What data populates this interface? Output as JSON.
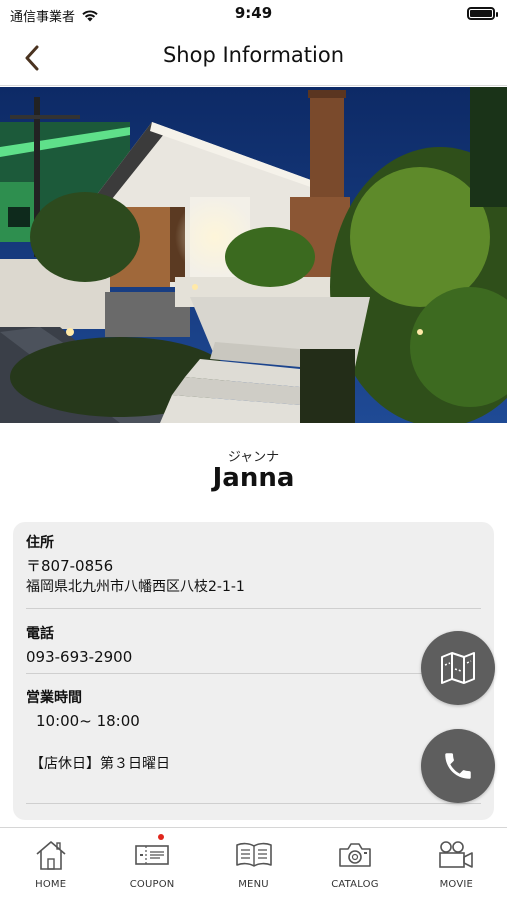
{
  "status_bar": {
    "carrier": "通信事業者",
    "time": "9:49"
  },
  "nav": {
    "title": "Shop Information"
  },
  "shop": {
    "name_kana": "ジャンナ",
    "name": "Janna"
  },
  "info": {
    "address": {
      "label": "住所",
      "postal": "〒807-0856",
      "line": "福岡県北九州市八幡西区八枝2-1-1"
    },
    "phone": {
      "label": "電話",
      "number": "093-693-2900"
    },
    "hours": {
      "label": "営業時間",
      "time": "10:00~ 18:00",
      "closed": "【店休日】第３日曜日"
    }
  },
  "tabs": [
    {
      "label": "HOME",
      "icon": "home-icon"
    },
    {
      "label": "COUPON",
      "icon": "coupon-icon",
      "badge": true
    },
    {
      "label": "MENU",
      "icon": "menu-book-icon"
    },
    {
      "label": "CATALOG",
      "icon": "camera-icon"
    },
    {
      "label": "MOVIE",
      "icon": "movie-camera-icon"
    }
  ],
  "colors": {
    "fab": "#5e5e5e",
    "card_bg": "#efefef",
    "badge": "#e0261c",
    "sky": "#0f2f6e"
  }
}
